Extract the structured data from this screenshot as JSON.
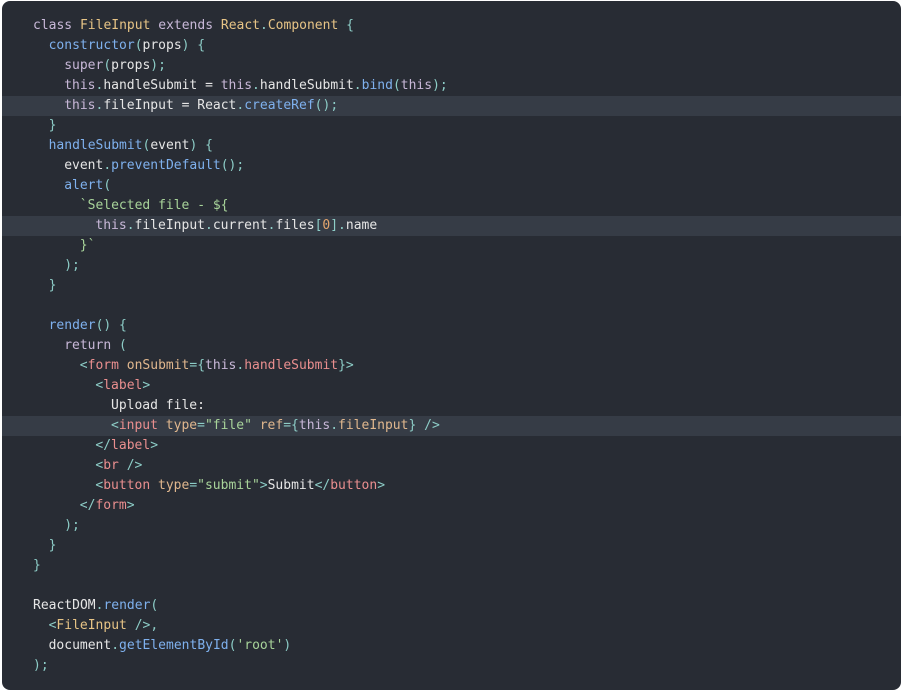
{
  "theme": {
    "background": "#282c34",
    "highlight_line": "#363c46",
    "colors": {
      "keyword": "#c8b8d8",
      "class": "#e7c486",
      "punct": "#8dcdc7",
      "plain": "#e6e6e6",
      "fn": "#7fb1ee",
      "string": "#a8d49a",
      "number": "#e4a56d",
      "tag": "#ea8f8f",
      "attr": "#e0b78e"
    }
  },
  "code": {
    "lines": [
      {
        "indent": 0,
        "hl": false,
        "tokens": [
          [
            "keyword",
            "class "
          ],
          [
            "class",
            "FileInput "
          ],
          [
            "keyword",
            "extends "
          ],
          [
            "class",
            "React"
          ],
          [
            "punct",
            "."
          ],
          [
            "class",
            "Component "
          ],
          [
            "punct",
            "{"
          ]
        ]
      },
      {
        "indent": 1,
        "hl": false,
        "tokens": [
          [
            "fn",
            "constructor"
          ],
          [
            "punct",
            "("
          ],
          [
            "plain",
            "props"
          ],
          [
            "punct",
            ") {"
          ]
        ]
      },
      {
        "indent": 2,
        "hl": false,
        "tokens": [
          [
            "keyword",
            "super"
          ],
          [
            "punct",
            "("
          ],
          [
            "plain",
            "props"
          ],
          [
            "punct",
            ");"
          ]
        ]
      },
      {
        "indent": 2,
        "hl": false,
        "tokens": [
          [
            "this",
            "this"
          ],
          [
            "punct",
            "."
          ],
          [
            "plain",
            "handleSubmit = "
          ],
          [
            "this",
            "this"
          ],
          [
            "punct",
            "."
          ],
          [
            "plain",
            "handleSubmit"
          ],
          [
            "punct",
            "."
          ],
          [
            "fn",
            "bind"
          ],
          [
            "punct",
            "("
          ],
          [
            "this",
            "this"
          ],
          [
            "punct",
            ");"
          ]
        ]
      },
      {
        "indent": 2,
        "hl": true,
        "tokens": [
          [
            "this",
            "this"
          ],
          [
            "punct",
            "."
          ],
          [
            "plain",
            "fileInput = React"
          ],
          [
            "punct",
            "."
          ],
          [
            "fn",
            "createRef"
          ],
          [
            "punct",
            "();"
          ]
        ]
      },
      {
        "indent": 1,
        "hl": false,
        "tokens": [
          [
            "punct",
            "}"
          ]
        ]
      },
      {
        "indent": 1,
        "hl": false,
        "tokens": [
          [
            "fn",
            "handleSubmit"
          ],
          [
            "punct",
            "("
          ],
          [
            "plain",
            "event"
          ],
          [
            "punct",
            ") {"
          ]
        ]
      },
      {
        "indent": 2,
        "hl": false,
        "tokens": [
          [
            "plain",
            "event"
          ],
          [
            "punct",
            "."
          ],
          [
            "fn",
            "preventDefault"
          ],
          [
            "punct",
            "();"
          ]
        ]
      },
      {
        "indent": 2,
        "hl": false,
        "tokens": [
          [
            "fn",
            "alert"
          ],
          [
            "punct",
            "("
          ]
        ]
      },
      {
        "indent": 3,
        "hl": false,
        "tokens": [
          [
            "string",
            "`Selected file - ${"
          ]
        ]
      },
      {
        "indent": 4,
        "hl": true,
        "tokens": [
          [
            "this",
            "this"
          ],
          [
            "punct",
            "."
          ],
          [
            "plain",
            "fileInput"
          ],
          [
            "punct",
            "."
          ],
          [
            "plain",
            "current"
          ],
          [
            "punct",
            "."
          ],
          [
            "plain",
            "files"
          ],
          [
            "punct",
            "["
          ],
          [
            "number",
            "0"
          ],
          [
            "punct",
            "]."
          ],
          [
            "plain",
            "name"
          ]
        ]
      },
      {
        "indent": 3,
        "hl": false,
        "tokens": [
          [
            "string",
            "}`"
          ]
        ]
      },
      {
        "indent": 2,
        "hl": false,
        "tokens": [
          [
            "punct",
            ");"
          ]
        ]
      },
      {
        "indent": 1,
        "hl": false,
        "tokens": [
          [
            "punct",
            "}"
          ]
        ]
      },
      {
        "indent": 0,
        "hl": false,
        "tokens": []
      },
      {
        "indent": 1,
        "hl": false,
        "tokens": [
          [
            "fn",
            "render"
          ],
          [
            "punct",
            "() {"
          ]
        ]
      },
      {
        "indent": 2,
        "hl": false,
        "tokens": [
          [
            "keyword",
            "return "
          ],
          [
            "punct",
            "("
          ]
        ]
      },
      {
        "indent": 3,
        "hl": false,
        "tokens": [
          [
            "punct",
            "<"
          ],
          [
            "tag",
            "form "
          ],
          [
            "attr",
            "onSubmit"
          ],
          [
            "punct",
            "={"
          ],
          [
            "this",
            "this"
          ],
          [
            "punct",
            "."
          ],
          [
            "tag",
            "handleSubmit"
          ],
          [
            "punct",
            "}>"
          ]
        ]
      },
      {
        "indent": 4,
        "hl": false,
        "tokens": [
          [
            "punct",
            "<"
          ],
          [
            "tag",
            "label"
          ],
          [
            "punct",
            ">"
          ]
        ]
      },
      {
        "indent": 5,
        "hl": false,
        "tokens": [
          [
            "plain",
            "Upload file:"
          ]
        ]
      },
      {
        "indent": 5,
        "hl": true,
        "tokens": [
          [
            "punct",
            "<"
          ],
          [
            "tag",
            "input "
          ],
          [
            "attr",
            "type"
          ],
          [
            "punct",
            "="
          ],
          [
            "string",
            "\"file\" "
          ],
          [
            "attr",
            "ref"
          ],
          [
            "punct",
            "={"
          ],
          [
            "this",
            "this"
          ],
          [
            "punct",
            "."
          ],
          [
            "attr",
            "fileInput"
          ],
          [
            "punct",
            "} />"
          ]
        ]
      },
      {
        "indent": 4,
        "hl": false,
        "tokens": [
          [
            "punct",
            "</"
          ],
          [
            "tag",
            "label"
          ],
          [
            "punct",
            ">"
          ]
        ]
      },
      {
        "indent": 4,
        "hl": false,
        "tokens": [
          [
            "punct",
            "<"
          ],
          [
            "tag",
            "br "
          ],
          [
            "punct",
            "/>"
          ]
        ]
      },
      {
        "indent": 4,
        "hl": false,
        "tokens": [
          [
            "punct",
            "<"
          ],
          [
            "tag",
            "button "
          ],
          [
            "attr",
            "type"
          ],
          [
            "punct",
            "="
          ],
          [
            "string",
            "\"submit\""
          ],
          [
            "punct",
            ">"
          ],
          [
            "plain",
            "Submit"
          ],
          [
            "punct",
            "</"
          ],
          [
            "tag",
            "button"
          ],
          [
            "punct",
            ">"
          ]
        ]
      },
      {
        "indent": 3,
        "hl": false,
        "tokens": [
          [
            "punct",
            "</"
          ],
          [
            "tag",
            "form"
          ],
          [
            "punct",
            ">"
          ]
        ]
      },
      {
        "indent": 2,
        "hl": false,
        "tokens": [
          [
            "punct",
            ");"
          ]
        ]
      },
      {
        "indent": 1,
        "hl": false,
        "tokens": [
          [
            "punct",
            "}"
          ]
        ]
      },
      {
        "indent": 0,
        "hl": false,
        "tokens": [
          [
            "punct",
            "}"
          ]
        ]
      },
      {
        "indent": 0,
        "hl": false,
        "tokens": []
      },
      {
        "indent": 0,
        "hl": false,
        "tokens": [
          [
            "plain",
            "ReactDOM"
          ],
          [
            "punct",
            "."
          ],
          [
            "fn",
            "render"
          ],
          [
            "punct",
            "("
          ]
        ]
      },
      {
        "indent": 1,
        "hl": false,
        "tokens": [
          [
            "punct",
            "<"
          ],
          [
            "comp",
            "FileInput "
          ],
          [
            "punct",
            "/>,"
          ]
        ]
      },
      {
        "indent": 1,
        "hl": false,
        "tokens": [
          [
            "plain",
            "document"
          ],
          [
            "punct",
            "."
          ],
          [
            "fn",
            "getElementById"
          ],
          [
            "punct",
            "("
          ],
          [
            "string",
            "'root'"
          ],
          [
            "punct",
            ")"
          ]
        ]
      },
      {
        "indent": 0,
        "hl": false,
        "tokens": [
          [
            "punct",
            ");"
          ]
        ]
      }
    ]
  }
}
